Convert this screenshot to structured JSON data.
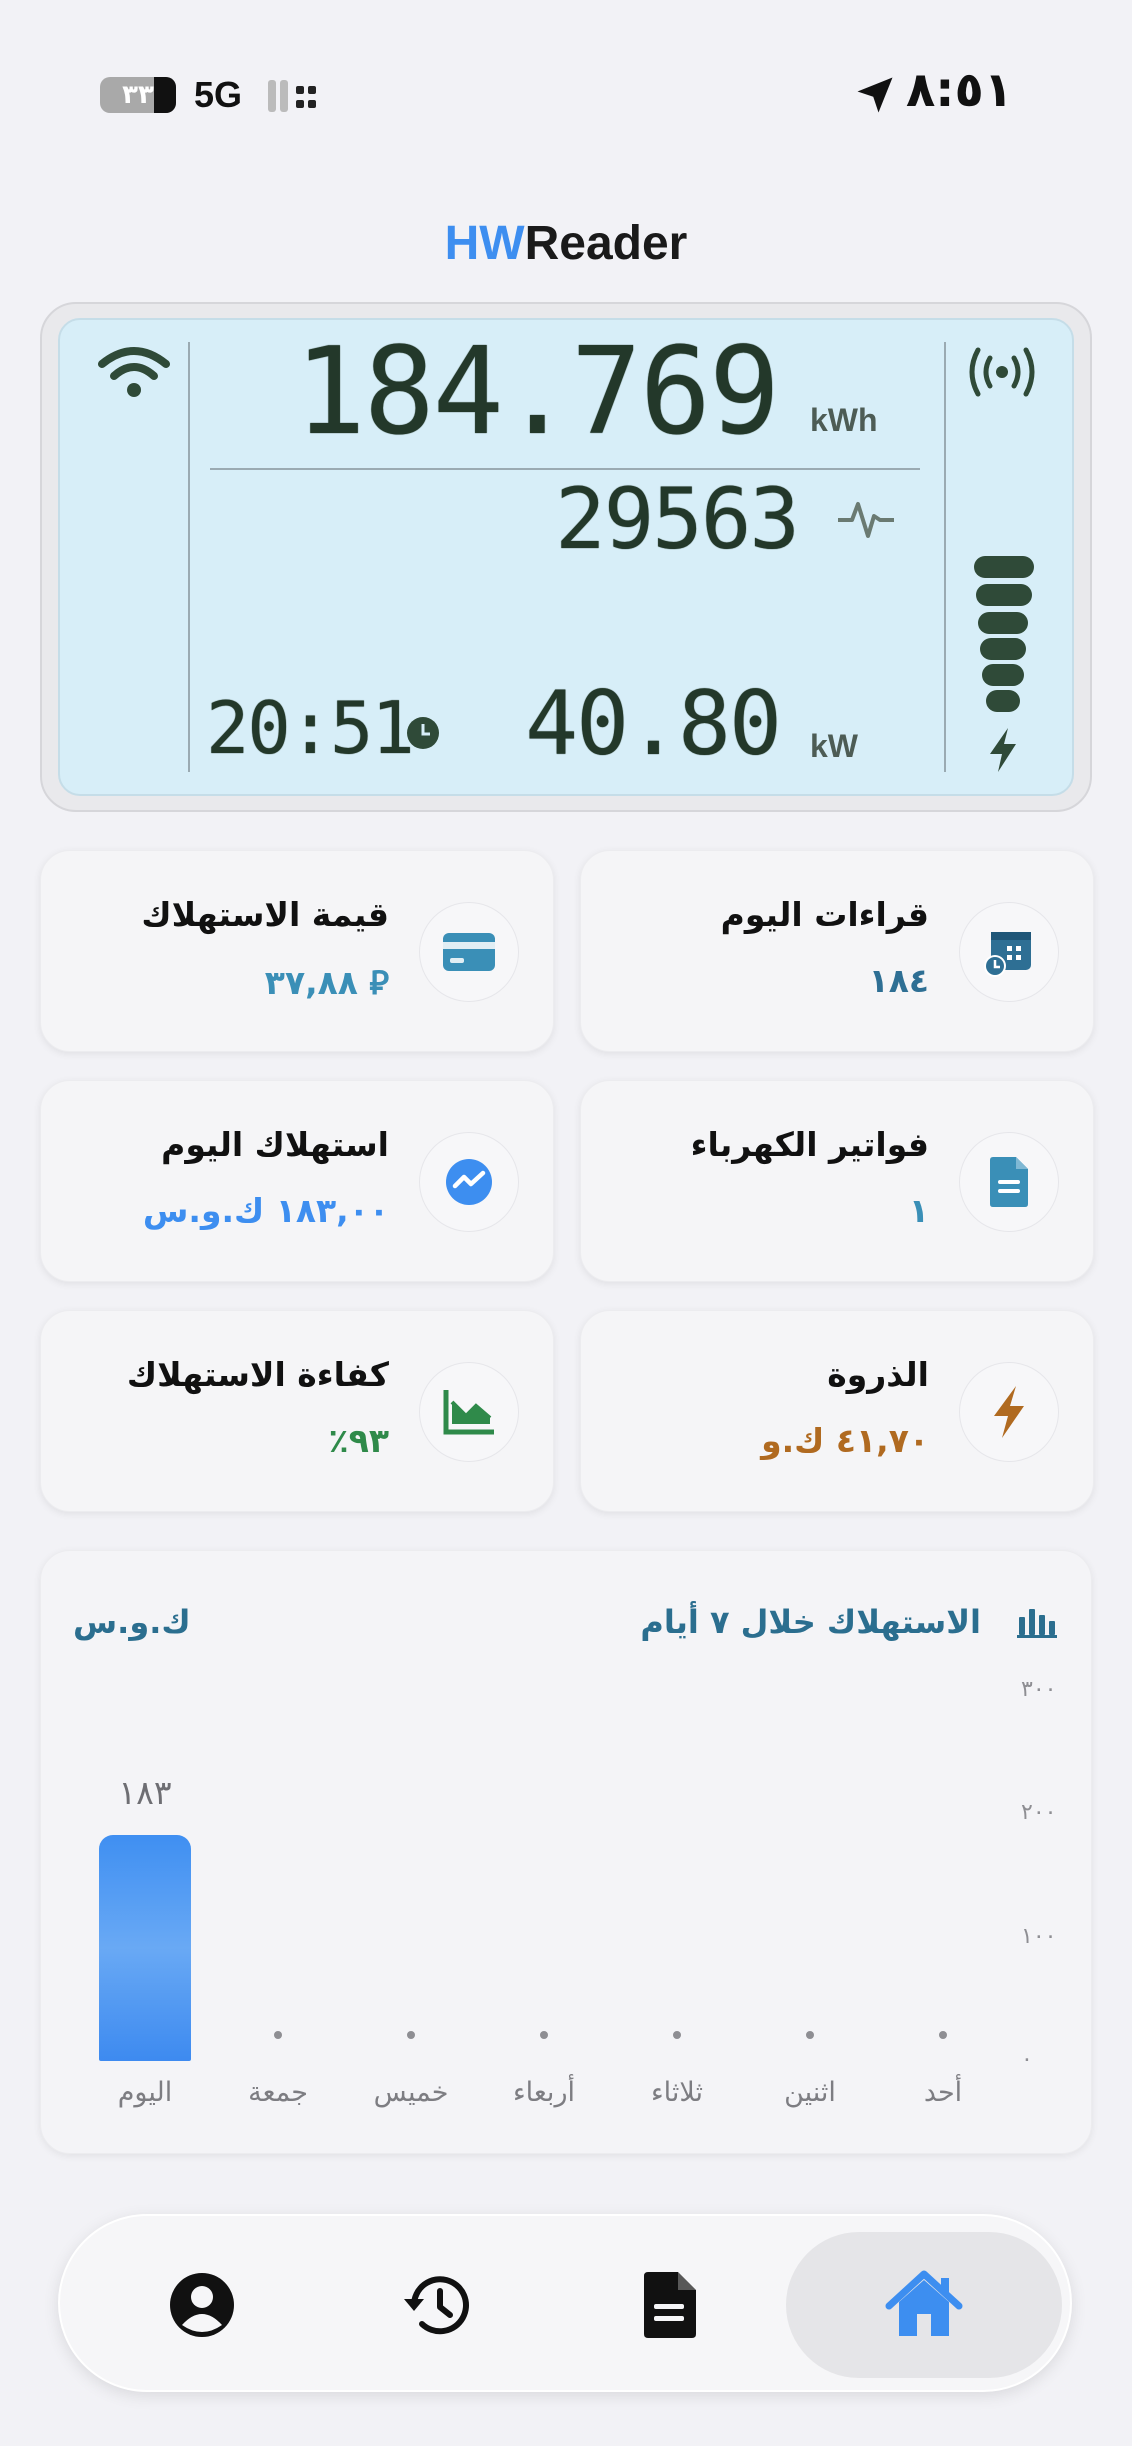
{
  "status_bar": {
    "time": "٨:٥١",
    "network": "5G",
    "battery": "٣٣"
  },
  "app": {
    "title_accent": "HW",
    "title_rest": "Reader"
  },
  "meter": {
    "energy_reading": "184.769",
    "energy_unit": "kWh",
    "pulse_reading": "29563",
    "power_reading": "40.80",
    "power_unit": "kW",
    "meter_time": "20:51"
  },
  "cards": [
    {
      "label": "قيمة الاستهلاك",
      "value": "٣٧,٨٨ ⃁",
      "icon": "credit-card-icon",
      "color": "#3a8fb7"
    },
    {
      "label": "قراءات اليوم",
      "value": "١٨٤",
      "icon": "calendar-clock-icon",
      "color": "#2e6f94"
    },
    {
      "label": "استهلاك اليوم",
      "value": "١٨٣,٠٠ ك.و.س",
      "icon": "activity-icon",
      "color": "#3d8ef0"
    },
    {
      "label": "فواتير الكهرباء",
      "value": "١",
      "icon": "document-icon",
      "color": "#3a8fb7"
    },
    {
      "label": "كفاءة الاستهلاك",
      "value": "٪٩٣",
      "icon": "efficiency-chart-icon",
      "color": "#2f8a4a"
    },
    {
      "label": "الذروة",
      "value": "٤١,٧٠ ك.و",
      "icon": "bolt-icon",
      "color": "#b06a20"
    }
  ],
  "chart_data": {
    "type": "bar",
    "title": "الاستهلاك خلال ٧ أيام",
    "unit_label": "ك.و.س",
    "categories": [
      "أحد",
      "اثنين",
      "ثلاثاء",
      "أربعاء",
      "خميس",
      "جمعة",
      "اليوم"
    ],
    "values": [
      0,
      0,
      0,
      0,
      0,
      0,
      183
    ],
    "value_label": "١٨٣",
    "ylim": [
      0,
      300
    ],
    "yticks": [
      "٠",
      "١٠٠",
      "٢٠٠",
      "٣٠٠"
    ],
    "accent": "#3d8ef0"
  },
  "tabs": [
    {
      "name": "home",
      "icon": "home-icon",
      "active": true
    },
    {
      "name": "bills",
      "icon": "document-icon",
      "active": false
    },
    {
      "name": "history",
      "icon": "history-icon",
      "active": false
    },
    {
      "name": "profile",
      "icon": "profile-icon",
      "active": false
    }
  ]
}
